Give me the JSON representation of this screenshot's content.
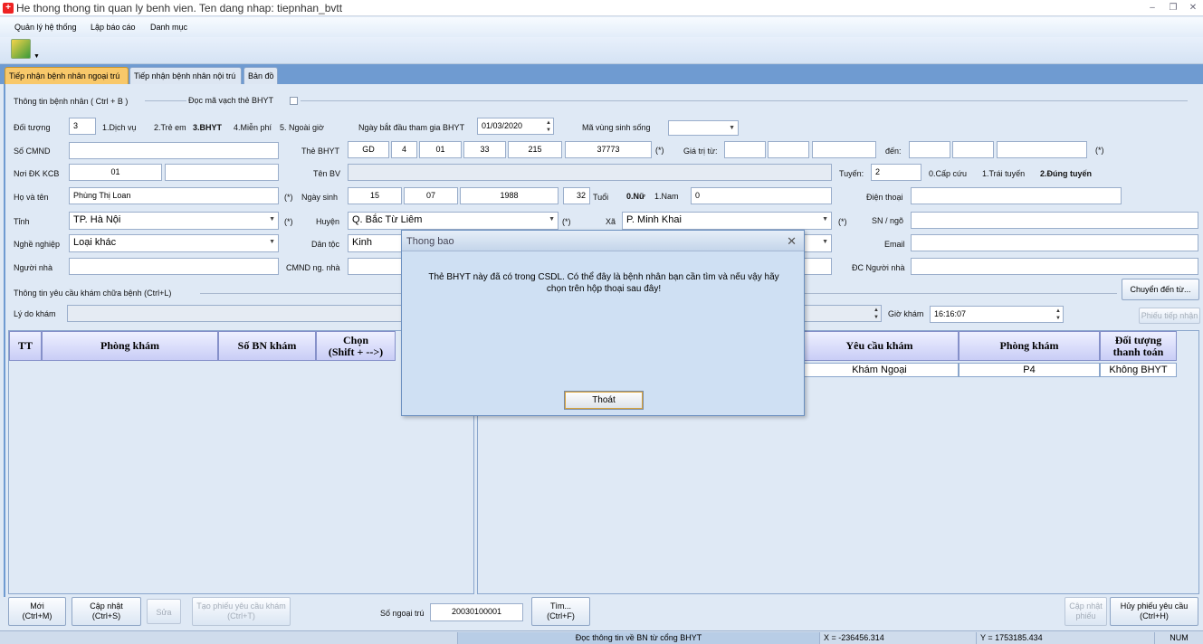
{
  "window": {
    "title": "He thong thong tin quan ly benh vien. Ten dang nhap: tiepnhan_bvtt",
    "icon": "hospital-cross-icon"
  },
  "menu": [
    "Quản lý hệ thống",
    "Lập báo cáo",
    "Danh mục"
  ],
  "tabs": [
    "Tiếp nhận bệnh nhân ngoại trú",
    "Tiếp nhận bệnh nhân nội trú",
    "Bản đồ"
  ],
  "patient": {
    "section_label": "Thông tin bệnh nhân ( Ctrl + B )",
    "barcode_label": "Đọc mã vạch thẻ BHYT",
    "doi_tuong_label": "Đối tượng",
    "doi_tuong_value": "3",
    "doi_tuong_options": [
      "1.Dịch vụ",
      "2.Trẻ em",
      "3.BHYT",
      "4.Miễn phí",
      "5. Ngoài giờ"
    ],
    "ngay_bd_label": "Ngày bắt đầu tham gia BHYT",
    "ngay_bd_value": "01/03/2020",
    "ma_vung_label": "Mã vùng sinh sống",
    "so_cmnd_label": "Số CMND",
    "the_bhyt_label": "Thẻ BHYT",
    "the_bhyt_parts": [
      "GD",
      "4",
      "01",
      "33",
      "215",
      "37773"
    ],
    "star": "(*)",
    "gia_tri_label": "Giá trị từ:",
    "den_label": "đến:",
    "noi_dk_label": "Nơi ĐK KCB",
    "noi_dk_value": "01",
    "ten_bv_label": "Tên BV",
    "tuyen_label": "Tuyến:",
    "tuyen_value": "2",
    "tuyen_options": [
      "0.Cấp cứu",
      "1.Trái tuyến",
      "2.Đúng tuyến"
    ],
    "ho_ten_label": "Họ và tên",
    "ho_ten_value": "Phùng Thị Loan",
    "ngay_sinh_label": "Ngày sinh",
    "ngay_sinh": [
      "15",
      "07",
      "1988"
    ],
    "tuoi_value": "32",
    "tuoi_label": "Tuổi",
    "gioi_nu": "0.Nữ",
    "gioi_nam": "1.Nam",
    "gioi_value": "0",
    "dien_thoai_label": "Điện thoại",
    "tinh_label": "Tỉnh",
    "tinh_value": "TP. Hà Nội",
    "huyen_label": "Huyện",
    "huyen_value": "Q. Bắc Từ Liêm",
    "xa_label": "Xã",
    "xa_value": "P. Minh Khai",
    "sn_ngo_label": "SN / ngõ",
    "nghe_label": "Nghề nghiệp",
    "nghe_value": "Loại khác",
    "dan_toc_label": "Dân tộc",
    "dan_toc_value": "Kinh",
    "email_label": "Email",
    "nguoi_nha_label": "Người nhà",
    "cmnd_nn_label": "CMND ng. nhà",
    "dc_nn_label": "ĐC Người nhà"
  },
  "request": {
    "section_label": "Thông tin yêu cầu khám chữa bệnh (Ctrl+L)",
    "chuyen_button": "Chuyển đến từ...",
    "ly_do_label": "Lý do khám",
    "gio_kham_label": "Giờ khám",
    "gio_kham_value": "16:16:07",
    "phieu_button": "Phiếu tiếp nhận"
  },
  "left_grid": {
    "headers": [
      "TT",
      "Phòng khám",
      "Số BN khám",
      "Chọn",
      "(Shift + -->)"
    ]
  },
  "right_grid": {
    "headers": [
      "Yêu cầu khám",
      "Phòng khám",
      "Đối tượng",
      "thanh toán"
    ],
    "rows": [
      [
        "Khám Ngoại",
        "P4",
        "Không BHYT"
      ]
    ]
  },
  "dialog": {
    "title": "Thong bao",
    "line1": "Thẻ BHYT này đã có trong CSDL. Có thể đây là bệnh nhân bạn cần tìm và nếu vậy hãy",
    "line2": "chọn trên hộp thoại sau đây!",
    "ok_label": "Thoát"
  },
  "buttons": {
    "moi": [
      "Mới",
      "(Ctrl+M)"
    ],
    "cap_nhat": [
      "Cập nhật",
      "(Ctrl+S)"
    ],
    "sua": "Sửa",
    "tao_phieu": [
      "Tạo phiếu yêu cầu khám",
      "(Ctrl+T)"
    ],
    "so_ngoai_tru_label": "Số ngoại trú",
    "so_ngoai_tru_value": "20030100001",
    "tim": [
      "Tìm...",
      "(Ctrl+F)"
    ],
    "cap_nhat_phieu": [
      "Cập nhật",
      "phiếu"
    ],
    "huy_phieu": [
      "Hủy phiếu yêu cầu",
      "(Ctrl+H)"
    ]
  },
  "status": {
    "message": "Đọc thông tin về BN từ cổng BHYT",
    "x": "X = -236456.314",
    "y": "Y = 1753185.434",
    "num": "NUM"
  }
}
